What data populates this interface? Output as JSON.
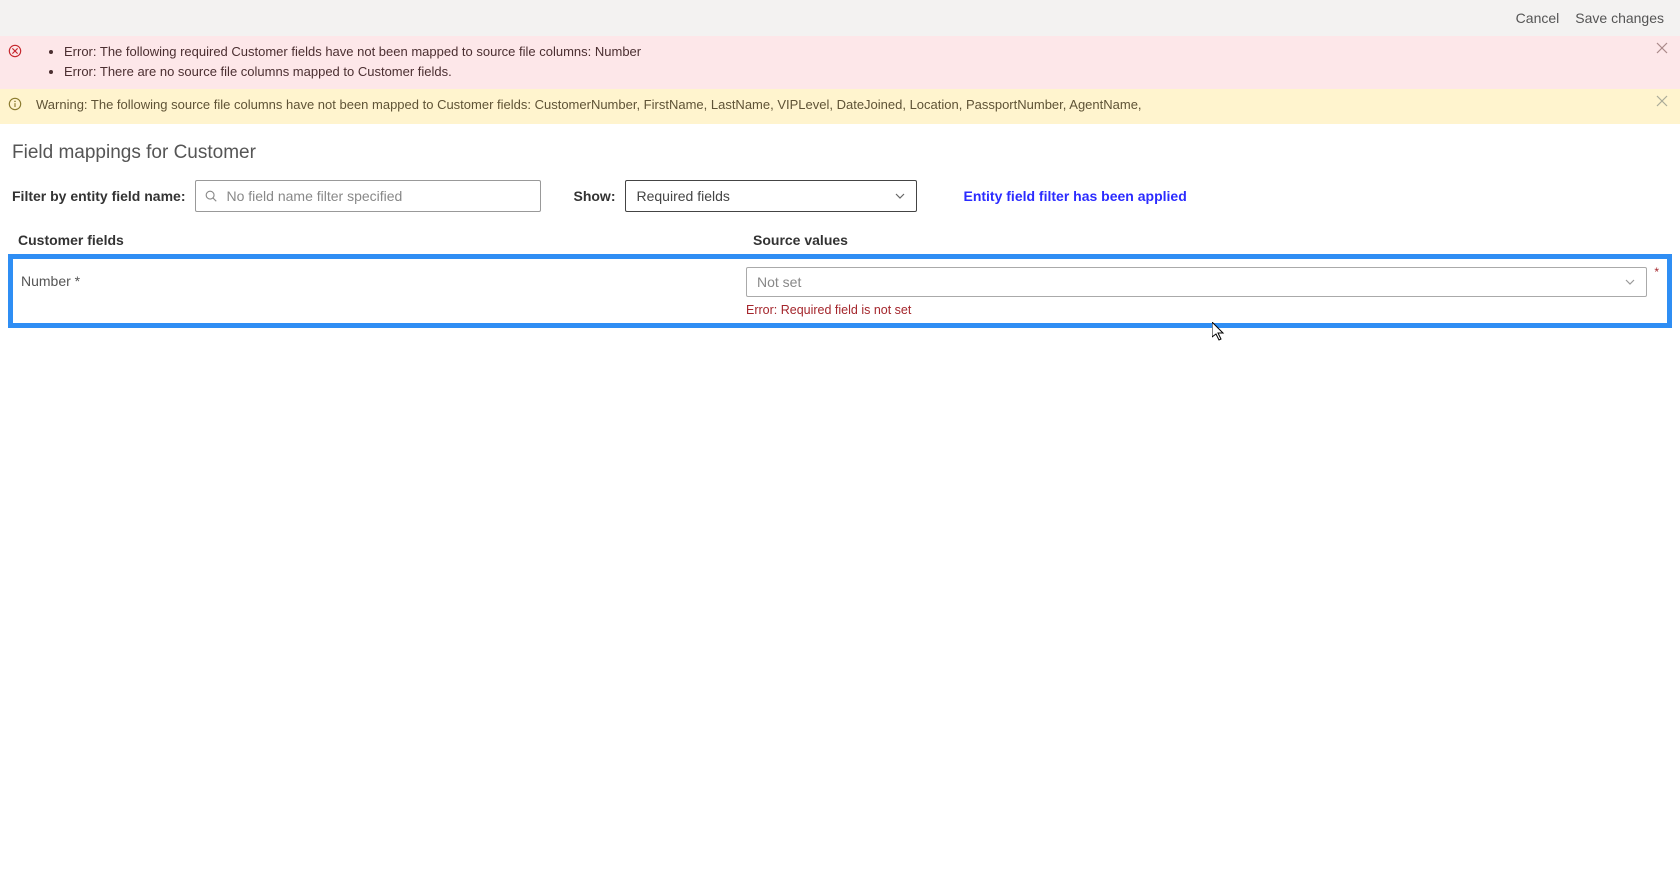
{
  "topbar": {
    "cancel": "Cancel",
    "save": "Save changes"
  },
  "error_banner": {
    "items": [
      "Error: The following required Customer fields have not been mapped to source file columns: Number",
      "Error: There are no source file columns mapped to Customer fields."
    ]
  },
  "warning_banner": {
    "text": "Warning: The following source file columns have not been mapped to Customer fields: CustomerNumber, FirstName, LastName, VIPLevel, DateJoined, Location, PassportNumber, AgentName,"
  },
  "page_title": "Field mappings for Customer",
  "filter": {
    "label": "Filter by entity field name:",
    "placeholder": "No field name filter specified",
    "show_label": "Show:",
    "show_value": "Required fields",
    "applied_msg": "Entity field filter has been applied"
  },
  "table": {
    "col_customer": "Customer fields",
    "col_source": "Source values"
  },
  "row": {
    "field_label": "Number *",
    "source_value": "Not set",
    "field_error": "Error: Required field is not set"
  }
}
